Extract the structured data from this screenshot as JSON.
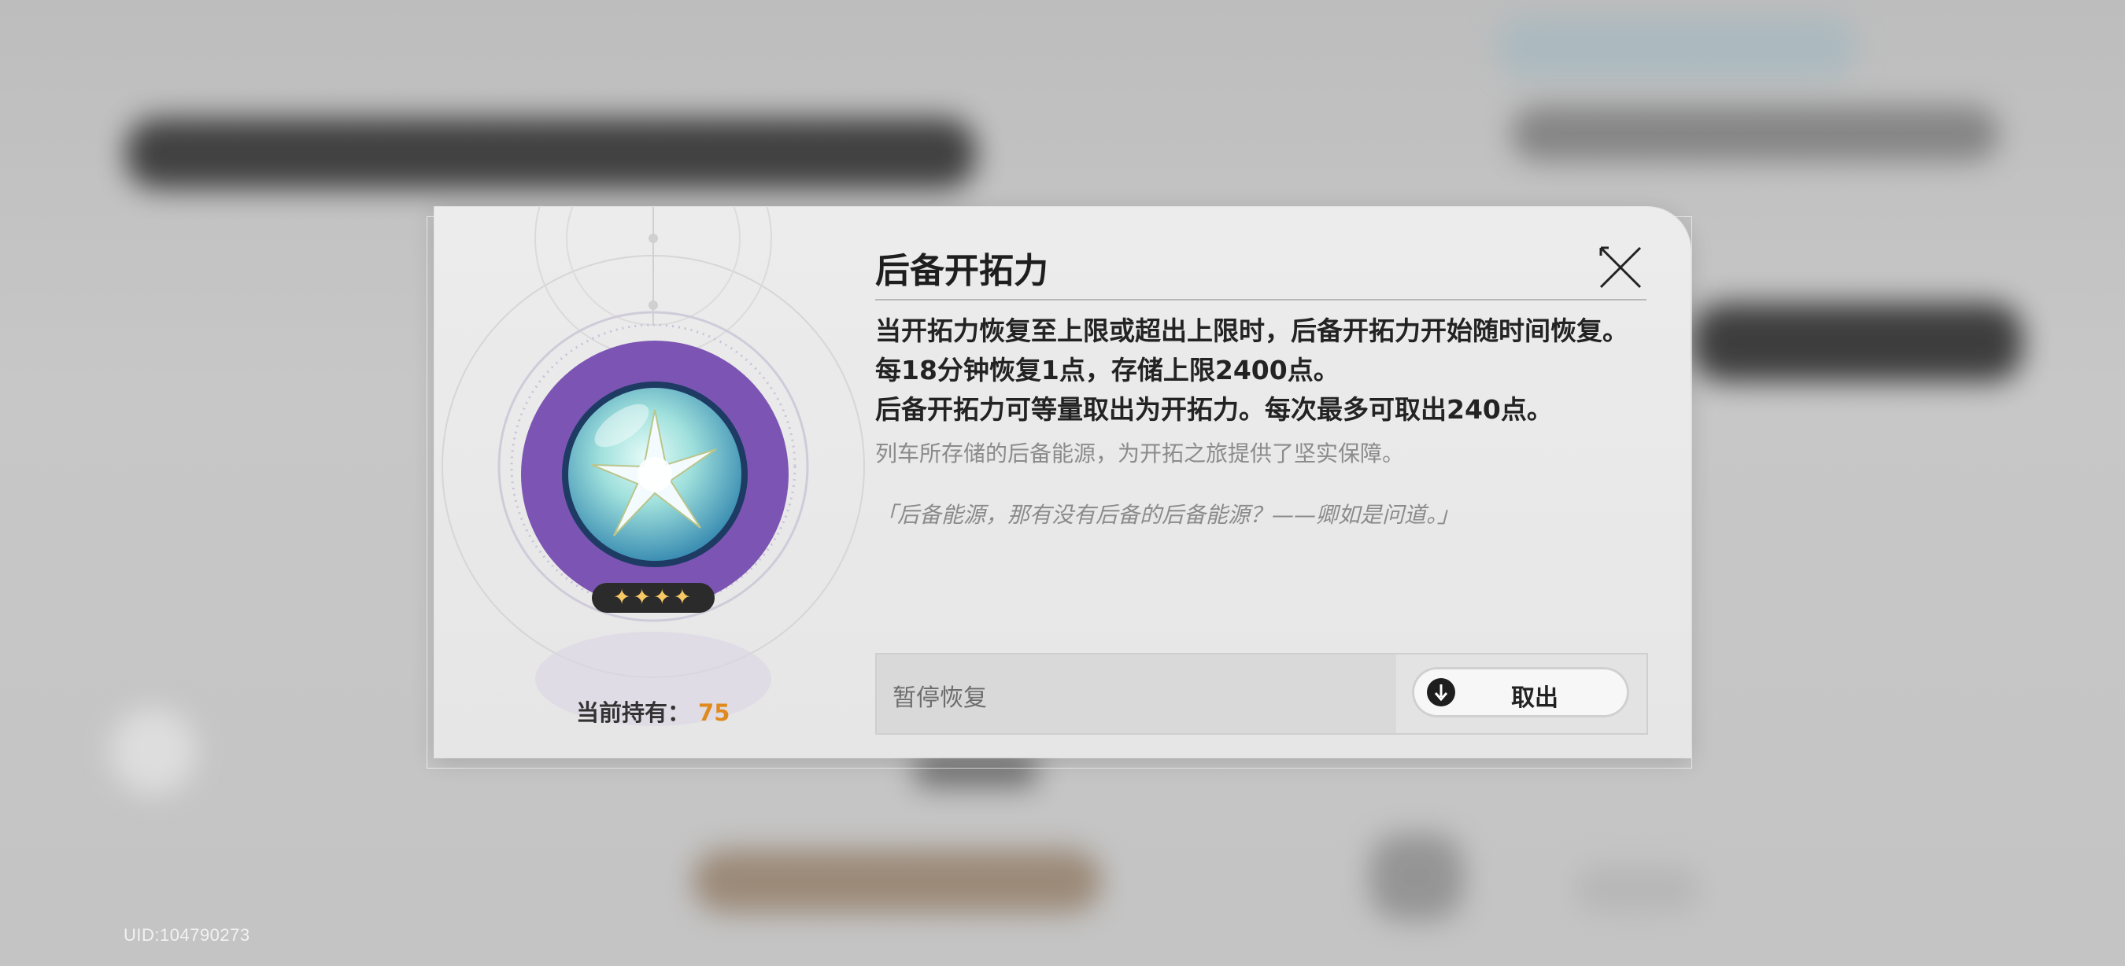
{
  "dialog": {
    "title": "后备开拓力",
    "description_lines": [
      "当开拓力恢复至上限或超出上限时，后备开拓力开始随时间恢复。每18分钟恢复1点，存储上限2400点。",
      "后备开拓力可等量取出为开拓力。每次最多可取出240点。"
    ],
    "flavor_text": "列车所存储的后备能源，为开拓之旅提供了坚实保障。",
    "quote": "「后备能源，那有没有后备的后备能源？——卿如是问道。」",
    "rarity_stars": "✦✦✦✦",
    "holding_label": "当前持有：",
    "holding_count": "75",
    "pause_label": "暂停恢复",
    "withdraw_label": "取出"
  },
  "uid": "UID:104790273",
  "colors": {
    "orb_purple": "#7c55b4",
    "count_orange": "#e08a1e",
    "star_gold": "#f7c865"
  }
}
